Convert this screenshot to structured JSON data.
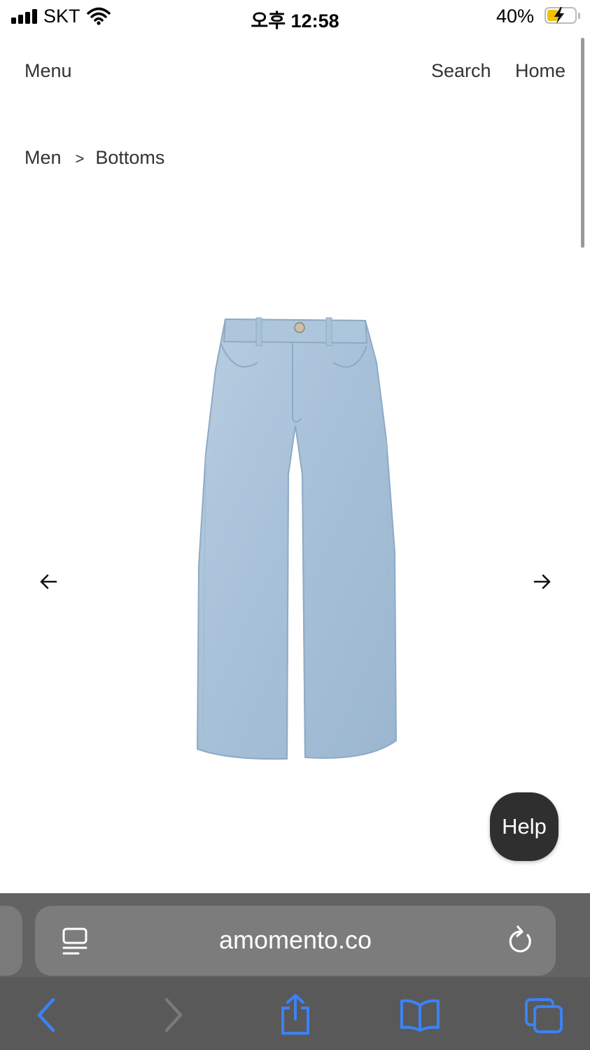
{
  "status_bar": {
    "carrier": "SKT",
    "time": "오후 12:58",
    "battery_percent": "40%",
    "battery_level": 0.4,
    "battery_color": "#f2c200"
  },
  "header": {
    "menu_label": "Menu",
    "search_label": "Search",
    "home_label": "Home"
  },
  "breadcrumb": {
    "items": [
      "Men",
      "Bottoms"
    ],
    "separator": ">"
  },
  "product": {
    "image_icon": "denim-jeans-image",
    "denim_color": "#a9c3db"
  },
  "carousel": {
    "prev_icon": "arrow-left-icon",
    "next_icon": "arrow-right-icon"
  },
  "help_button": {
    "label": "Help"
  },
  "browser": {
    "url": "amomento.co",
    "reader_icon": "reader-mode-icon",
    "reload_icon": "reload-icon",
    "toolbar": [
      "back-icon",
      "forward-icon",
      "share-icon",
      "bookmarks-icon",
      "tabs-icon"
    ],
    "accent_color": "#3b82f6"
  }
}
